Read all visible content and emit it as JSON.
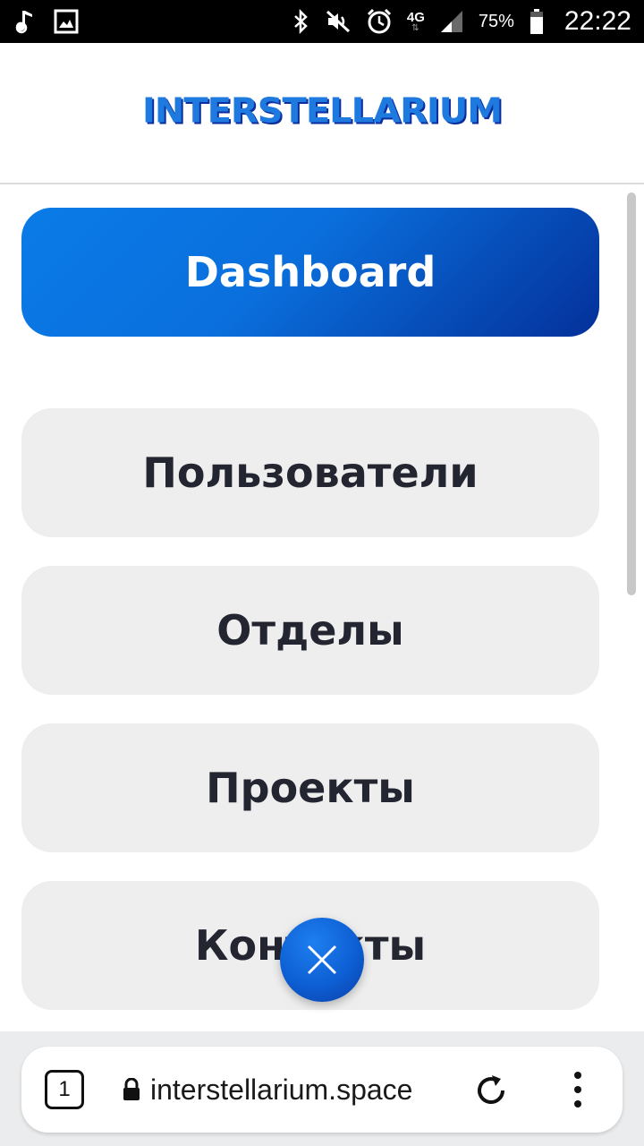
{
  "status_bar": {
    "battery": "75%",
    "time": "22:22",
    "network": "4G",
    "icons": [
      "music-note-icon",
      "image-icon",
      "bluetooth-icon",
      "mute-icon",
      "alarm-icon",
      "signal-icon",
      "battery-icon"
    ]
  },
  "header": {
    "logo": "INTERSTELLARIUM"
  },
  "nav": {
    "items": [
      {
        "label": "Dashboard",
        "active": true
      },
      {
        "label": "Пользователи",
        "active": false
      },
      {
        "label": "Отделы",
        "active": false
      },
      {
        "label": "Проекты",
        "active": false
      },
      {
        "label": "Контакты",
        "active": false
      }
    ]
  },
  "browser": {
    "tab_count": "1",
    "url": "interstellarium.space"
  },
  "colors": {
    "accent_start": "#0a7be8",
    "accent_end": "#04309a",
    "button_bg": "#eeeeee",
    "text_dark": "#232530"
  }
}
